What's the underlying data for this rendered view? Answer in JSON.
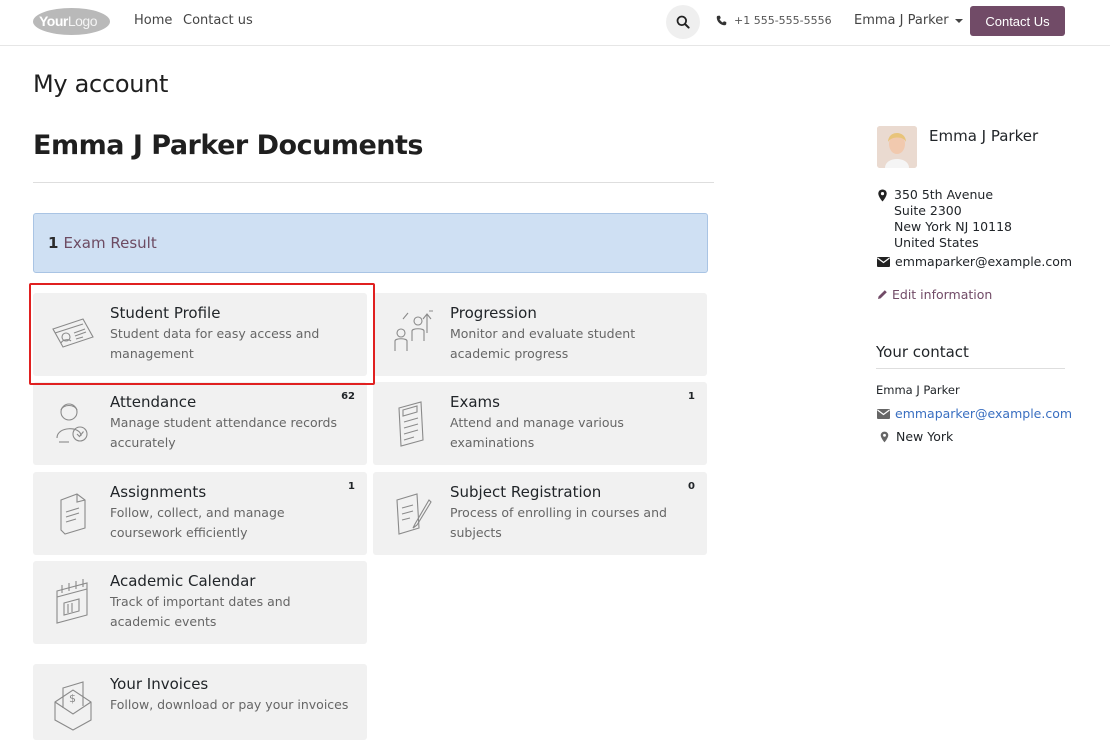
{
  "header": {
    "logo_text_bold": "Your",
    "logo_text_light": "Logo",
    "nav": [
      "Home",
      "Contact us"
    ],
    "phone": "+1 555-555-5556",
    "user": "Emma J Parker",
    "cta_label": "Contact Us",
    "cta_color": "#714b67"
  },
  "main": {
    "page_title": "My account",
    "docs_title": "Emma J Parker Documents",
    "alert": {
      "count": "1",
      "label": "Exam Result"
    },
    "cards": [
      {
        "title": "Student Profile",
        "desc": "Student data for easy access and management",
        "count": "",
        "icon": "id-card-icon"
      },
      {
        "title": "Progression",
        "desc": "Monitor and evaluate student academic progress",
        "count": "",
        "icon": "progression-icon"
      },
      {
        "title": "Attendance",
        "desc": "Manage student attendance records accurately",
        "count": "62",
        "icon": "attendance-icon"
      },
      {
        "title": "Exams",
        "desc": "Attend and manage various examinations",
        "count": "1",
        "icon": "exam-sheet-icon"
      },
      {
        "title": "Assignments",
        "desc": "Follow, collect, and manage coursework efficiently",
        "count": "1",
        "icon": "assignment-icon"
      },
      {
        "title": "Subject Registration",
        "desc": "Process of enrolling in courses and subjects",
        "count": "0",
        "icon": "registration-icon"
      },
      {
        "title": "Academic Calendar",
        "desc": "Track of important dates and academic events",
        "count": "",
        "icon": "calendar-icon"
      },
      {
        "title": "Your Invoices",
        "desc": "Follow, download or pay your invoices",
        "count": "",
        "icon": "invoice-icon"
      }
    ]
  },
  "sidebar": {
    "name": "Emma J Parker",
    "address": [
      "350 5th Avenue",
      "Suite 2300",
      "New York NJ 10118",
      "United States"
    ],
    "email": "emmaparker@example.com",
    "edit_label": "Edit information",
    "contact_heading": "Your contact",
    "contact_name": "Emma J Parker",
    "contact_email": "emmaparker@example.com",
    "contact_city": "New York"
  }
}
